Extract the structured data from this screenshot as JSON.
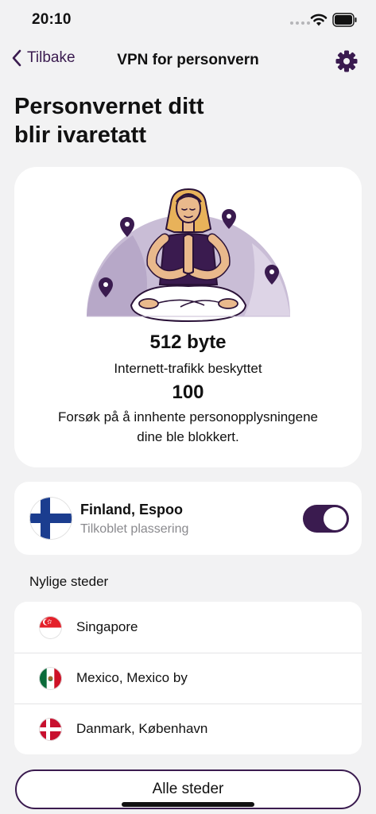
{
  "status_bar": {
    "time": "20:10"
  },
  "nav": {
    "back_label": "Tilbake",
    "title": "VPN for personvern"
  },
  "page_title_line1": "Personvernet ditt",
  "page_title_line2": "blir ivaretatt",
  "stats": {
    "traffic_value": "512 byte",
    "traffic_label": "Internett-trafikk beskyttet",
    "blocked_value": "100",
    "blocked_label_line1": "Forsøk på å innhente personopplysningene",
    "blocked_label_line2": "dine ble blokkert."
  },
  "connection": {
    "location": "Finland, Espoo",
    "status": "Tilkoblet plassering",
    "enabled": true
  },
  "recent": {
    "heading": "Nylige steder",
    "items": [
      {
        "name": "Singapore",
        "flag": "singapore-flag-icon"
      },
      {
        "name": "Mexico, Mexico by",
        "flag": "mexico-flag-icon"
      },
      {
        "name": "Danmark, København",
        "flag": "denmark-flag-icon"
      }
    ]
  },
  "all_places_label": "Alle steder",
  "colors": {
    "accent": "#3a1b4f",
    "background": "#f2f2f3",
    "illustration_bg": "#c9bdd6"
  }
}
